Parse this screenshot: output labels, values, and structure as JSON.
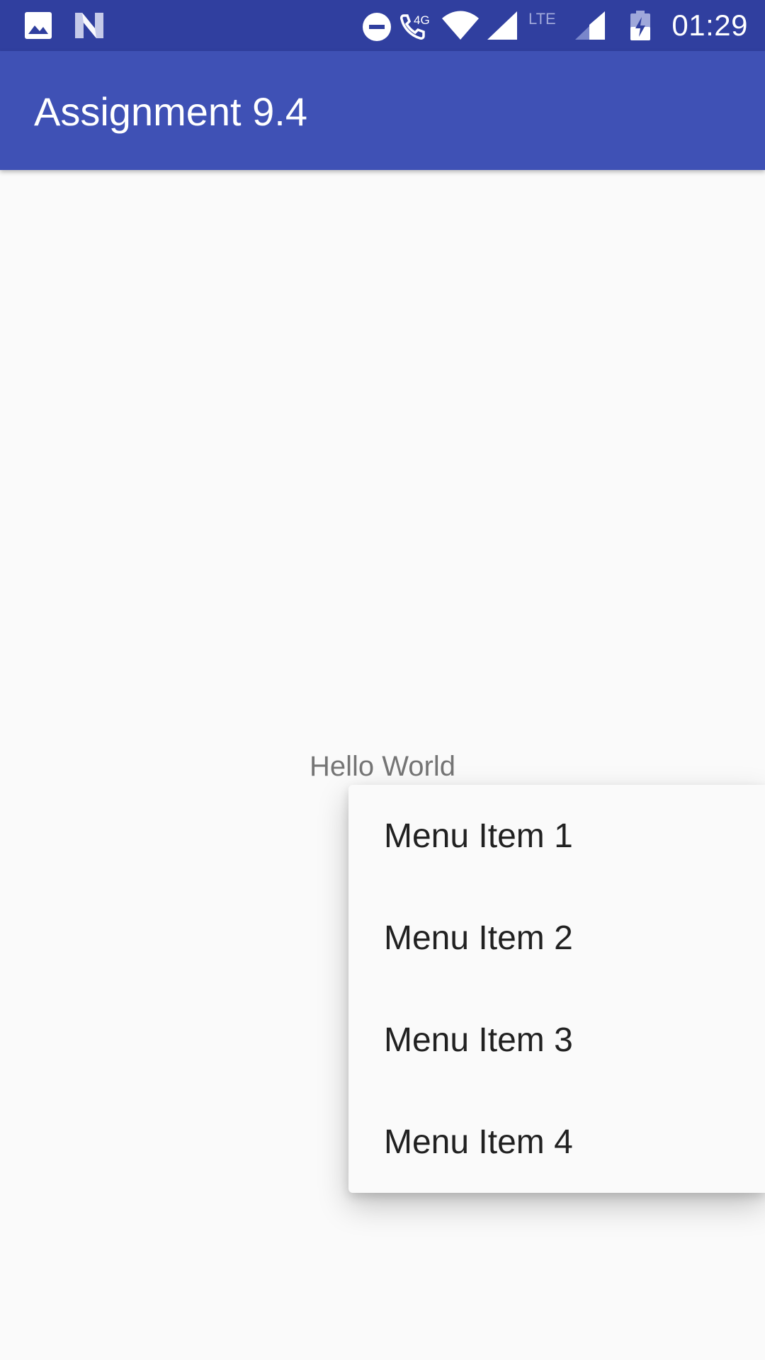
{
  "status_bar": {
    "time": "01:29",
    "network_label": "4G",
    "lte_label": "LTE",
    "icons": [
      "image-notification-icon",
      "n-logo-icon",
      "do-not-disturb-icon",
      "wifi-calling-icon",
      "wifi-icon",
      "signal-icon",
      "lte-signal-icon",
      "battery-charging-icon"
    ],
    "background": "#303f9f"
  },
  "app_bar": {
    "title": "Assignment 9.4",
    "background": "#3f51b5"
  },
  "main": {
    "hello_text": "Hello World"
  },
  "popup_menu": {
    "items": [
      {
        "label": "Menu Item 1"
      },
      {
        "label": "Menu Item 2"
      },
      {
        "label": "Menu Item 3"
      },
      {
        "label": "Menu Item 4"
      }
    ]
  }
}
